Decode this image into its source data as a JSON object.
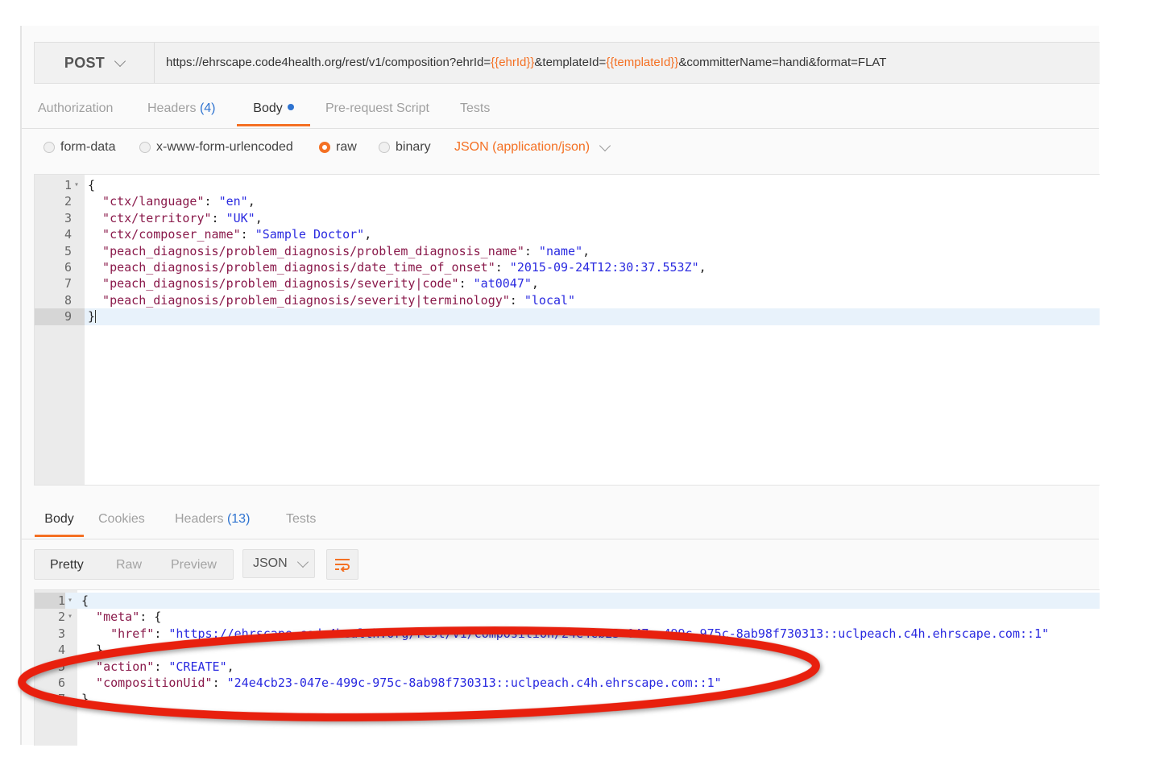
{
  "request": {
    "method": "POST",
    "url_parts": [
      {
        "text": "https://ehrscape.code4health.org/rest/v1/composition?ehrId=",
        "var": false
      },
      {
        "text": "{{ehrId}}",
        "var": true
      },
      {
        "text": "&templateId=",
        "var": false
      },
      {
        "text": "{{templateId}}",
        "var": true
      },
      {
        "text": "&committerName=handi&format=FLAT",
        "var": false
      }
    ]
  },
  "request_tabs": {
    "authorization": "Authorization",
    "headers": "Headers",
    "headers_count": "(4)",
    "body": "Body",
    "prerequest": "Pre-request Script",
    "tests": "Tests"
  },
  "body_types": {
    "form_data": "form-data",
    "urlencoded": "x-www-form-urlencoded",
    "raw": "raw",
    "binary": "binary",
    "content_type": "JSON (application/json)"
  },
  "request_body": {
    "lines": [
      {
        "num": "1",
        "fold": "▾",
        "parts": [
          {
            "t": "{",
            "c": "p"
          }
        ]
      },
      {
        "num": "2",
        "parts": [
          {
            "t": "  \"ctx/language\"",
            "c": "k"
          },
          {
            "t": ": ",
            "c": "p"
          },
          {
            "t": "\"en\"",
            "c": "s"
          },
          {
            "t": ",",
            "c": "p"
          }
        ]
      },
      {
        "num": "3",
        "parts": [
          {
            "t": "  \"ctx/territory\"",
            "c": "k"
          },
          {
            "t": ": ",
            "c": "p"
          },
          {
            "t": "\"UK\"",
            "c": "s"
          },
          {
            "t": ",",
            "c": "p"
          }
        ]
      },
      {
        "num": "4",
        "parts": [
          {
            "t": "  \"ctx/composer_name\"",
            "c": "k"
          },
          {
            "t": ": ",
            "c": "p"
          },
          {
            "t": "\"Sample Doctor\"",
            "c": "s"
          },
          {
            "t": ",",
            "c": "p"
          }
        ]
      },
      {
        "num": "5",
        "parts": [
          {
            "t": "  \"peach_diagnosis/problem_diagnosis/problem_diagnosis_name\"",
            "c": "k"
          },
          {
            "t": ": ",
            "c": "p"
          },
          {
            "t": "\"name\"",
            "c": "s"
          },
          {
            "t": ",",
            "c": "p"
          }
        ]
      },
      {
        "num": "6",
        "parts": [
          {
            "t": "  \"peach_diagnosis/problem_diagnosis/date_time_of_onset\"",
            "c": "k"
          },
          {
            "t": ": ",
            "c": "p"
          },
          {
            "t": "\"2015-09-24T12:30:37.553Z\"",
            "c": "s"
          },
          {
            "t": ",",
            "c": "p"
          }
        ]
      },
      {
        "num": "7",
        "parts": [
          {
            "t": "  \"peach_diagnosis/problem_diagnosis/severity|code\"",
            "c": "k"
          },
          {
            "t": ": ",
            "c": "p"
          },
          {
            "t": "\"at0047\"",
            "c": "s"
          },
          {
            "t": ",",
            "c": "p"
          }
        ]
      },
      {
        "num": "8",
        "parts": [
          {
            "t": "  \"peach_diagnosis/problem_diagnosis/severity|terminology\"",
            "c": "k"
          },
          {
            "t": ": ",
            "c": "p"
          },
          {
            "t": "\"local\"",
            "c": "s"
          }
        ]
      },
      {
        "num": "9",
        "hl": true,
        "cursor": true,
        "parts": [
          {
            "t": "}",
            "c": "p"
          }
        ]
      }
    ]
  },
  "response_tabs": {
    "body": "Body",
    "cookies": "Cookies",
    "headers": "Headers",
    "headers_count": "(13)",
    "tests": "Tests"
  },
  "response_toolbar": {
    "pretty": "Pretty",
    "raw": "Raw",
    "preview": "Preview",
    "format": "JSON"
  },
  "response_body": {
    "lines": [
      {
        "num": "1",
        "fold": "▾",
        "hl": true,
        "parts": [
          {
            "t": "{",
            "c": "p"
          }
        ]
      },
      {
        "num": "2",
        "fold": "▾",
        "parts": [
          {
            "t": "  \"meta\"",
            "c": "k"
          },
          {
            "t": ": {",
            "c": "p"
          }
        ]
      },
      {
        "num": "3",
        "parts": [
          {
            "t": "    \"href\"",
            "c": "k"
          },
          {
            "t": ": ",
            "c": "p"
          },
          {
            "t": "\"https://ehrscape.code4health.org/rest/v1/composition/24e4cb23-047e-499c-975c-8ab98f730313::uclpeach.c4h.ehrscape.com::1\"",
            "c": "s"
          }
        ]
      },
      {
        "num": "4",
        "parts": [
          {
            "t": "  },",
            "c": "p"
          }
        ]
      },
      {
        "num": "5",
        "parts": [
          {
            "t": "  \"action\"",
            "c": "k"
          },
          {
            "t": ": ",
            "c": "p"
          },
          {
            "t": "\"CREATE\"",
            "c": "s"
          },
          {
            "t": ",",
            "c": "p"
          }
        ]
      },
      {
        "num": "6",
        "parts": [
          {
            "t": "  \"compositionUid\"",
            "c": "k"
          },
          {
            "t": ": ",
            "c": "p"
          },
          {
            "t": "\"24e4cb23-047e-499c-975c-8ab98f730313::uclpeach.c4h.ehrscape.com::1\"",
            "c": "s"
          }
        ]
      },
      {
        "num": "7",
        "parts": [
          {
            "t": "}",
            "c": "p"
          }
        ]
      }
    ]
  },
  "colors": {
    "accent": "#f47023",
    "count": "#2e73d0",
    "annotation": "#e8200e"
  },
  "icons": {
    "method_dropdown": "chevron-down-icon",
    "content_type_dropdown": "chevron-down-icon",
    "wrap": "wrap-lines-icon"
  }
}
